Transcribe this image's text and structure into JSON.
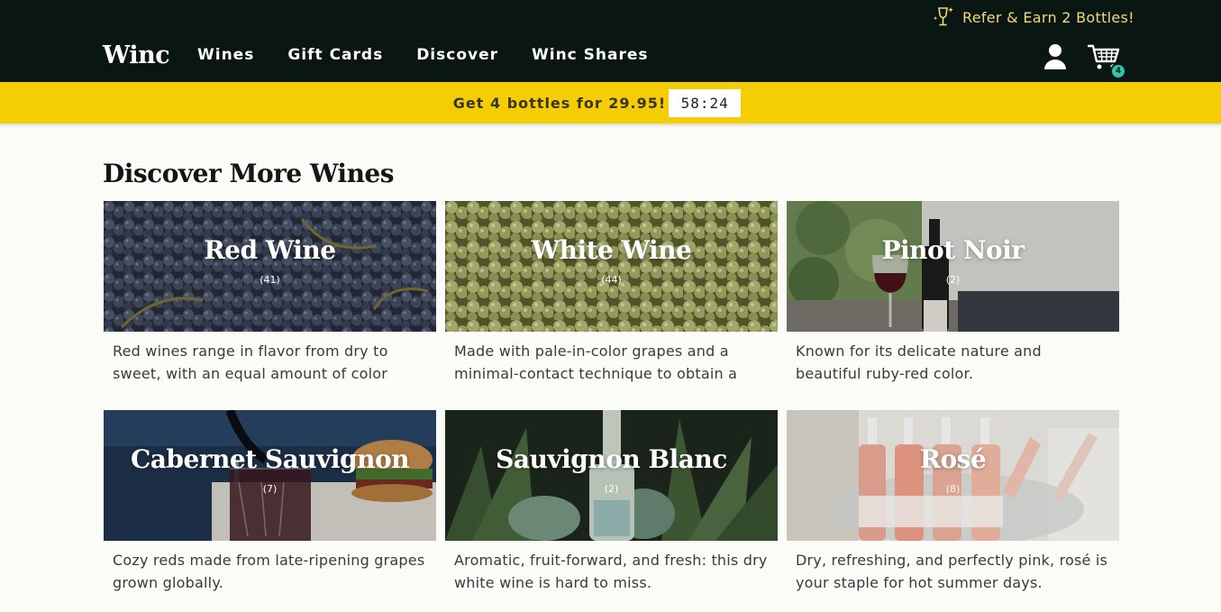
{
  "header": {
    "logo": "Winc",
    "refer": "Refer & Earn 2 Bottles!",
    "nav": [
      "Wines",
      "Gift Cards",
      "Discover",
      "Winc Shares"
    ],
    "cart_count": "4"
  },
  "promo": {
    "text": "Get 4 bottles for 29.95!",
    "timer": "58:24"
  },
  "section": {
    "title": "Discover More Wines"
  },
  "cards": [
    {
      "title": "Red Wine",
      "count": "(41)",
      "desc": "Red wines range in flavor from dry to sweet, with an equal amount of color variation."
    },
    {
      "title": "White Wine",
      "count": "(44)",
      "desc": "Made with pale-in-color grapes and a minimal-contact technique to obtain a light..."
    },
    {
      "title": "Pinot Noir",
      "count": "(2)",
      "desc": "Known for its delicate nature and beautiful ruby-red color."
    },
    {
      "title": "Cabernet Sauvignon",
      "count": "(7)",
      "desc": "Cozy reds made from late-ripening grapes grown globally."
    },
    {
      "title": "Sauvignon Blanc",
      "count": "(2)",
      "desc": "Aromatic, fruit-forward, and fresh: this dry white wine is hard to miss."
    },
    {
      "title": "Rosé",
      "count": "(8)",
      "desc": "Dry, refreshing, and perfectly pink, rosé is your staple for hot summer days."
    }
  ],
  "colors": {
    "header_bg": "#0a1612",
    "promo_bg": "#f4cd05",
    "refer_text": "#f3d97a",
    "cart_badge": "#2cc7a8"
  }
}
